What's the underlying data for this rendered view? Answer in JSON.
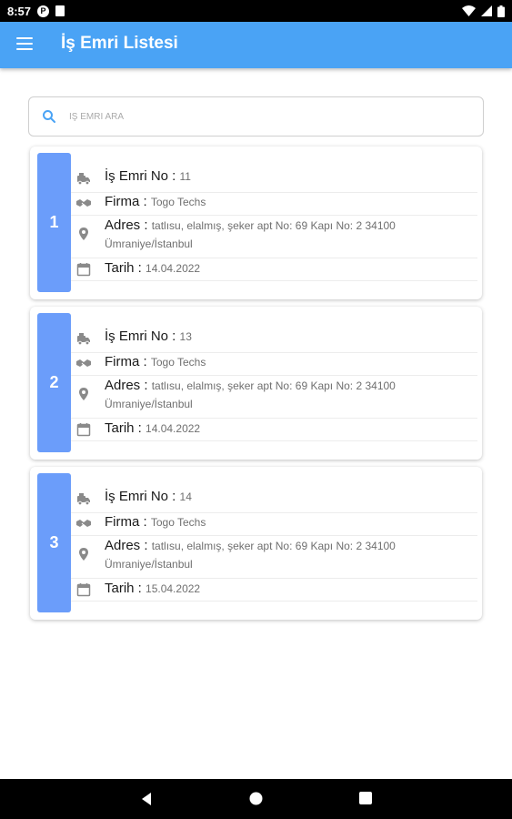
{
  "status_bar": {
    "time": "8:57",
    "p_badge": "P"
  },
  "app_bar": {
    "title": "İş Emri Listesi"
  },
  "search": {
    "placeholder": "İŞ EMRİ ARA"
  },
  "labels": {
    "order_no": "İş Emri No :",
    "company": "Firma :",
    "address": "Adres :",
    "date": "Tarih :"
  },
  "orders": [
    {
      "index": "1",
      "order_no": "11",
      "company": "Togo Techs",
      "address_line1": "tatlısu, elalmış, şeker apt No: 69 Kapı No: 2 34100",
      "address_line2": "Ümraniye/İstanbul",
      "date": "14.04.2022"
    },
    {
      "index": "2",
      "order_no": "13",
      "company": "Togo Techs",
      "address_line1": "tatlısu, elalmış, şeker apt No: 69 Kapı No: 2 34100",
      "address_line2": "Ümraniye/İstanbul",
      "date": "14.04.2022"
    },
    {
      "index": "3",
      "order_no": "14",
      "company": "Togo Techs",
      "address_line1": "tatlısu, elalmış, şeker apt No: 69 Kapı No: 2 34100",
      "address_line2": "Ümraniye/İstanbul",
      "date": "15.04.2022"
    }
  ],
  "icons": {
    "order": "vehicle-icon",
    "company": "handshake-icon",
    "address": "location-pin-icon",
    "date": "calendar-icon"
  },
  "colors": {
    "app_bar": "#4aa3f5",
    "card_index": "#6b9dfa",
    "icon_grey": "#8a8a8a"
  }
}
